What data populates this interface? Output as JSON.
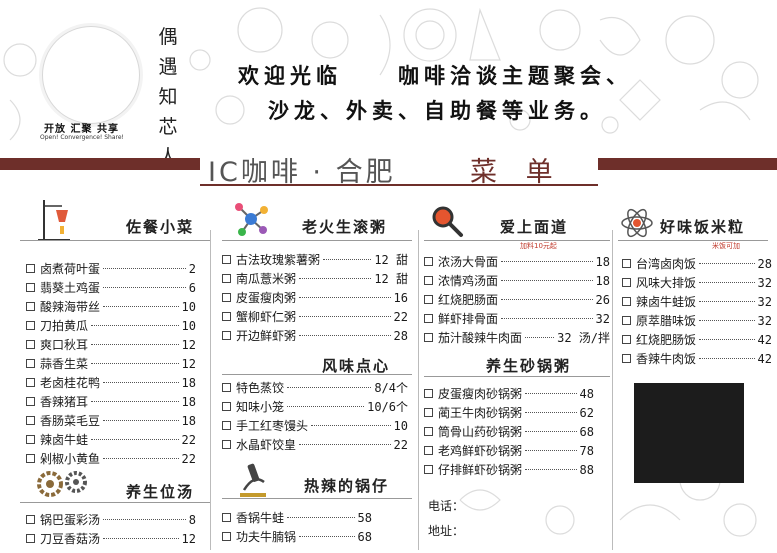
{
  "header": {
    "brand_name": [
      "偶",
      "遇",
      "知",
      "芯",
      "人"
    ],
    "slogan": "开放 汇聚 共享",
    "slogan_en": "Open! Convergence! Share!",
    "welcome_line_1a": "欢迎光临",
    "welcome_line_1b": "咖啡洽谈主题聚会、",
    "welcome_line_2": "沙龙、外卖、自助餐等业务。"
  },
  "banner": {
    "title": "IC咖啡 · 合肥",
    "menu_word": "菜 单"
  },
  "sections": {
    "zuocan": {
      "title": "佐餐小菜",
      "items": [
        {
          "name": "卤煮荷叶蛋",
          "price": "2"
        },
        {
          "name": "翡葵土鸡蛋",
          "price": "6"
        },
        {
          "name": "酸辣海带丝",
          "price": "10"
        },
        {
          "name": "刀拍黄瓜",
          "price": "10"
        },
        {
          "name": "爽口秋耳",
          "price": "12"
        },
        {
          "name": "蒜香生菜",
          "price": "12"
        },
        {
          "name": "老卤桂花鸭",
          "price": "18"
        },
        {
          "name": "香辣猪耳",
          "price": "18"
        },
        {
          "name": "香肠菜毛豆",
          "price": "18"
        },
        {
          "name": "辣卤牛蛙",
          "price": "22"
        },
        {
          "name": "剁椒小黄鱼",
          "price": "22"
        }
      ]
    },
    "yangsheng_tang": {
      "title": "养生位汤",
      "items": [
        {
          "name": "锅巴蛋彩汤",
          "price": "8"
        },
        {
          "name": "刀豆香菇汤",
          "price": "12"
        }
      ]
    },
    "laohuo": {
      "title": "老火生滚粥",
      "items": [
        {
          "name": "古法玫瑰紫薯粥",
          "price": "12 甜"
        },
        {
          "name": "南瓜薏米粥",
          "price": "12 甜"
        },
        {
          "name": "皮蛋瘦肉粥",
          "price": "16"
        },
        {
          "name": "蟹柳虾仁粥",
          "price": "22"
        },
        {
          "name": "开边鲜虾粥",
          "price": "28"
        }
      ]
    },
    "fengwei": {
      "title": "风味点心",
      "items": [
        {
          "name": "特色蒸饺",
          "price": "8/4个"
        },
        {
          "name": "知味小笼",
          "price": "10/6个"
        },
        {
          "name": "手工红枣馒头",
          "price": "10"
        },
        {
          "name": "水晶虾饺皇",
          "price": "22"
        }
      ]
    },
    "guozai": {
      "title": "热辣的锅仔",
      "items": [
        {
          "name": "香锅牛蛙",
          "price": "58"
        },
        {
          "name": "功夫牛腩锅",
          "price": "68"
        }
      ]
    },
    "mian": {
      "title": "爱上面道",
      "note": "加料10元起",
      "items": [
        {
          "name": "浓汤大骨面",
          "price": "18"
        },
        {
          "name": "浓情鸡汤面",
          "price": "18"
        },
        {
          "name": "红烧肥肠面",
          "price": "26"
        },
        {
          "name": "鲜虾排骨面",
          "price": "32"
        },
        {
          "name": "茄汁酸辣牛肉面",
          "price": "32 汤/拌"
        }
      ]
    },
    "shaguo": {
      "title": "养生砂锅粥",
      "items": [
        {
          "name": "皮蛋瘦肉砂锅粥",
          "price": "48"
        },
        {
          "name": "蔺王牛肉砂锅粥",
          "price": "62"
        },
        {
          "name": "筒骨山药砂锅粥",
          "price": "68"
        },
        {
          "name": "老鸡鲜虾砂锅粥",
          "price": "78"
        },
        {
          "name": "仔排鲜虾砂锅粥",
          "price": "88"
        }
      ]
    },
    "fanmi": {
      "title": "好味饭米粒",
      "note": "米饭可加",
      "items": [
        {
          "name": "台湾卤肉饭",
          "price": "28"
        },
        {
          "name": "风味大排饭",
          "price": "32"
        },
        {
          "name": "辣卤牛蛙饭",
          "price": "32"
        },
        {
          "name": "原萃腊味饭",
          "price": "32"
        },
        {
          "name": "红烧肥肠饭",
          "price": "42"
        },
        {
          "name": "香辣牛肉饭",
          "price": "42"
        }
      ]
    }
  },
  "contact": {
    "phone_label": "电话：",
    "address_label": "地址："
  },
  "colors": {
    "accent": "#6e2f2a",
    "text": "#1a1a1a"
  }
}
